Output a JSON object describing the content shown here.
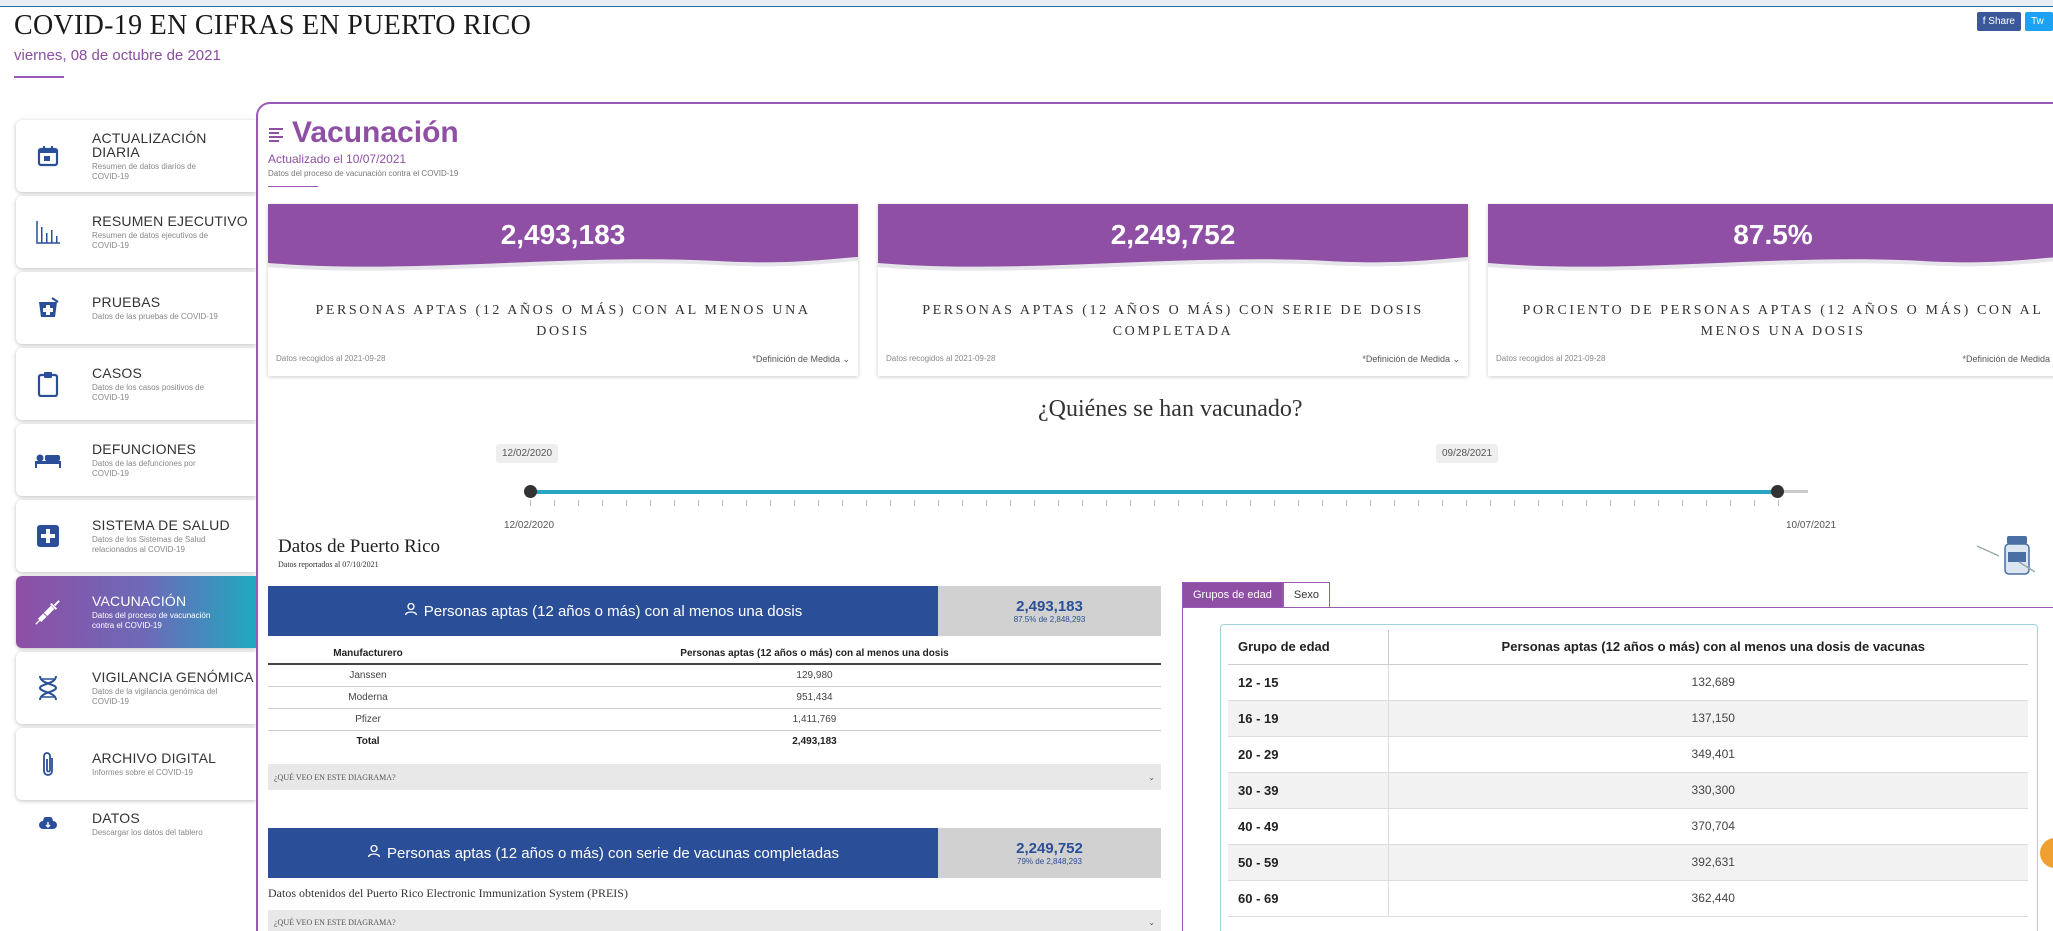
{
  "header": {
    "title": "COVID-19 EN CIFRAS EN PUERTO RICO",
    "date": "viernes, 08 de octubre de 2021",
    "share_facebook": "f Share",
    "share_twitter": "Tw"
  },
  "sidebar": {
    "items": [
      {
        "title": "ACTUALIZACIÓN DIARIA",
        "subtitle": "Resumen de datos diarios de COVID-19",
        "icon": "calendar-icon"
      },
      {
        "title": "RESUMEN EJECUTIVO",
        "subtitle": "Resumen de datos ejecutivos de COVID-19",
        "icon": "bar-chart-icon"
      },
      {
        "title": "PRUEBAS",
        "subtitle": "Datos de las pruebas de COVID-19",
        "icon": "test-kit-icon"
      },
      {
        "title": "CASOS",
        "subtitle": "Datos de los casos positivos de COVID-19",
        "icon": "clipboard-icon"
      },
      {
        "title": "DEFUNCIONES",
        "subtitle": "Datos de las defunciones por COVID-19",
        "icon": "bed-icon"
      },
      {
        "title": "SISTEMA DE SALUD",
        "subtitle": "Datos de los Sistemas de Salud relacionados al COVID-19",
        "icon": "medical-cross-icon"
      },
      {
        "title": "VACUNACIÓN",
        "subtitle": "Datos del proceso de vacunación contra el COVID-19",
        "icon": "syringe-icon"
      },
      {
        "title": "VIGILANCIA GENÓMICA",
        "subtitle": "Datos de la vigilancia genómica del COVID-19",
        "icon": "dna-icon"
      },
      {
        "title": "ARCHIVO DIGITAL",
        "subtitle": "Informes sobre el COVID-19",
        "icon": "paperclip-icon"
      },
      {
        "title": "DATOS",
        "subtitle": "Descargar los datos del tablero",
        "icon": "cloud-download-icon"
      }
    ],
    "active_color": "#8e4fa5"
  },
  "section": {
    "title": "Vacunación",
    "updated": "Actualizado el 10/07/2021",
    "description": "Datos del proceso de vacunación contra el COVID-19"
  },
  "cards": [
    {
      "value": "2,493,183",
      "label": "PERSONAS APTAS (12 AÑOS O MÁS) CON AL MENOS UNA DOSIS",
      "collected": "Datos recogidos al 2021-09-28",
      "definition": "*Definición de Medida ⌄"
    },
    {
      "value": "2,249,752",
      "label": "PERSONAS APTAS (12 AÑOS O MÁS) CON SERIE DE DOSIS COMPLETADA",
      "collected": "Datos recogidos al 2021-09-28",
      "definition": "*Definición de Medida ⌄"
    },
    {
      "value": "87.5%",
      "label": "PORCIENTO DE PERSONAS APTAS (12 AÑOS O MÁS) CON AL MENOS UNA DOSIS",
      "collected": "Datos recogidos al 2021-09-28",
      "definition": "*Definición de Medida"
    }
  ],
  "who": {
    "title": "¿Quiénes se han vacunado?",
    "slider_start_tip": "12/02/2020",
    "slider_end_tip": "09/28/2021",
    "range_start": "12/02/2020",
    "range_end": "10/07/2021"
  },
  "pr": {
    "title": "Datos de Puerto Rico",
    "subtitle": "Datos reportados al 07/10/2021"
  },
  "dose_one": {
    "bar_label": "Personas aptas (12 años o más) con al menos una dosis",
    "total": "2,493,183",
    "pct_of": "87.5% de 2,848,293",
    "headers": [
      "Manufacturero",
      "Personas aptas (12 años o más) con al menos una dosis"
    ],
    "rows": [
      [
        "Janssen",
        "129,980"
      ],
      [
        "Moderna",
        "951,434"
      ],
      [
        "Pfizer",
        "1,411,769"
      ],
      [
        "Total",
        "2,493,183"
      ]
    ],
    "que_veo": "¿QUÉ VEO EN ESTE DIAGRAMA?"
  },
  "dose_full": {
    "bar_label": "Personas aptas (12 años o más) con serie de vacunas completadas",
    "total": "2,249,752",
    "pct_of": "79% de 2,848,293",
    "source_note": "Datos obtenidos del Puerto Rico Electronic Immunization System (PREIS)",
    "que_veo": "¿QUÉ VEO EN ESTE DIAGRAMA?"
  },
  "tabs": [
    "Grupos de edad",
    "Sexo"
  ],
  "age_table": {
    "headers": [
      "Grupo de edad",
      "Personas aptas (12 años o más) con al menos una dosis de vacunas"
    ],
    "rows": [
      [
        "12 - 15",
        "132,689"
      ],
      [
        "16 - 19",
        "137,150"
      ],
      [
        "20 - 29",
        "349,401"
      ],
      [
        "30 - 39",
        "330,300"
      ],
      [
        "40 - 49",
        "370,704"
      ],
      [
        "50 - 59",
        "392,631"
      ],
      [
        "60 - 69",
        "362,440"
      ]
    ]
  }
}
